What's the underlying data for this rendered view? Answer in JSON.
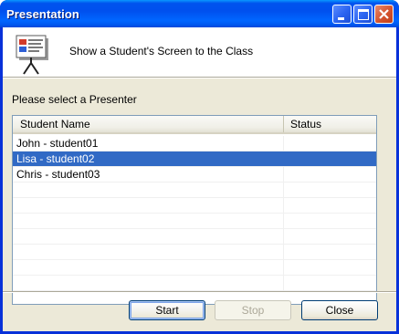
{
  "window": {
    "title": "Presentation",
    "controls": [
      "minimize-icon",
      "maximize-icon",
      "close-icon"
    ],
    "accent_color": "#0054e3",
    "close_color": "#d4532d"
  },
  "header": {
    "icon": "presentation-board-icon",
    "text": "Show a Student's Screen to the Class"
  },
  "prompt": "Please select a Presenter",
  "list": {
    "columns": [
      "Student Name",
      "Status"
    ],
    "rows": [
      {
        "name": "John - student01",
        "status": ""
      },
      {
        "name": "Lisa - student02",
        "status": ""
      },
      {
        "name": "Chris - student03",
        "status": ""
      }
    ],
    "selected_index": 1,
    "selection_color": "#316ac5"
  },
  "buttons": {
    "start": "Start",
    "stop": "Stop",
    "close": "Close"
  }
}
